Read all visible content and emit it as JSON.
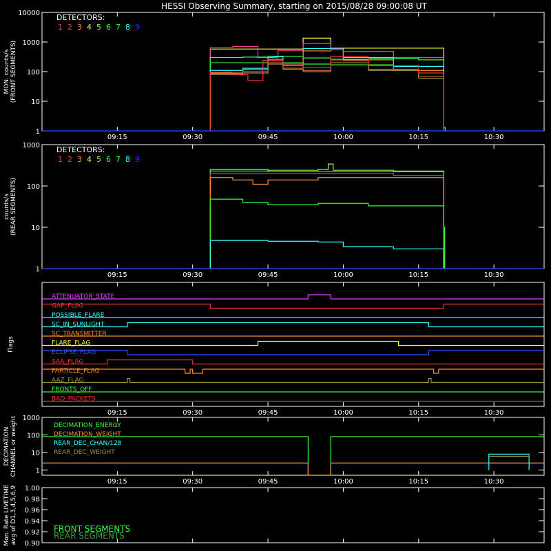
{
  "title": "HESSI Observing Summary, starting on 2015/08/28 09:00:08 UT",
  "time_ticks": [
    "09:15",
    "09:30",
    "09:45",
    "10:00",
    "10:15",
    "10:30"
  ],
  "detector_colors": [
    "#ff3050",
    "#ff3030",
    "#ff8c30",
    "#ffff30",
    "#90ff30",
    "#30ff60",
    "#30ff30",
    "#30ffff",
    "#3030ff"
  ],
  "chart_data": [
    {
      "type": "line",
      "ylabel_1": "MON. counts/s",
      "ylabel_2": "(FRONT SEGMENTS)",
      "yscale": "log",
      "ylim": [
        1,
        10000
      ],
      "xlim": [
        "09:00",
        "10:40"
      ],
      "yticks": [
        "10000",
        "1000",
        "100",
        "10",
        "1"
      ],
      "legend_title": "DETECTORS:",
      "legend_items": [
        "1",
        "2",
        "3",
        "4",
        "5",
        "6",
        "7",
        "8",
        "9"
      ],
      "series": [
        {
          "color": "#ffff40",
          "points": [
            [
              33.5,
              1
            ],
            [
              33.5,
              580
            ],
            [
              52,
              600
            ],
            [
              52,
              1350
            ],
            [
              57.5,
              1350
            ],
            [
              57.5,
              620
            ],
            [
              80,
              580
            ],
            [
              80,
              560
            ],
            [
              80,
              1
            ]
          ]
        },
        {
          "color": "#ff40a0",
          "points": [
            [
              33.5,
              1
            ],
            [
              33.5,
              650
            ],
            [
              38,
              700
            ],
            [
              43,
              300
            ],
            [
              47,
              520
            ],
            [
              52,
              420
            ],
            [
              52,
              900
            ],
            [
              57.5,
              900
            ],
            [
              57.5,
              600
            ],
            [
              60,
              480
            ],
            [
              70,
              300
            ],
            [
              80,
              200
            ],
            [
              80,
              1
            ]
          ]
        },
        {
          "color": "#30ff60",
          "points": [
            [
              33.5,
              1
            ],
            [
              33.5,
              300
            ],
            [
              40,
              310
            ],
            [
              46,
              330
            ],
            [
              52,
              290
            ],
            [
              57.5,
              260
            ],
            [
              65,
              280
            ],
            [
              75,
              250
            ],
            [
              80,
              240
            ],
            [
              80,
              1
            ]
          ]
        },
        {
          "color": "#30ff30",
          "points": [
            [
              33.5,
              1
            ],
            [
              33.5,
              200
            ],
            [
              42,
              200
            ],
            [
              52,
              180
            ],
            [
              57.5,
              170
            ],
            [
              70,
              150
            ],
            [
              80,
              140
            ],
            [
              80,
              1
            ]
          ]
        },
        {
          "color": "#30ffff",
          "points": [
            [
              33.5,
              1
            ],
            [
              33.5,
              110
            ],
            [
              40,
              130
            ],
            [
              45,
              320
            ],
            [
              48,
              180
            ],
            [
              52,
              150
            ],
            [
              52,
              600
            ],
            [
              57.5,
              620
            ],
            [
              60,
              300
            ],
            [
              70,
              150
            ],
            [
              80,
              90
            ],
            [
              80,
              1.3
            ],
            [
              80.3,
              1
            ]
          ]
        },
        {
          "color": "#ff8c30",
          "points": [
            [
              33.5,
              1
            ],
            [
              33.5,
              90
            ],
            [
              40,
              120
            ],
            [
              45,
              260
            ],
            [
              48,
              160
            ],
            [
              52,
              130
            ],
            [
              52,
              500
            ],
            [
              57.5,
              550
            ],
            [
              60,
              250
            ],
            [
              70,
              110
            ],
            [
              80,
              50
            ],
            [
              80,
              1
            ]
          ]
        },
        {
          "color": "#c06040",
          "points": [
            [
              33.5,
              1
            ],
            [
              33.5,
              85
            ],
            [
              40,
              100
            ],
            [
              45,
              200
            ],
            [
              48,
              130
            ],
            [
              52,
              110
            ],
            [
              57.5,
              230
            ],
            [
              65,
              120
            ],
            [
              75,
              70
            ],
            [
              80,
              45
            ],
            [
              80,
              1
            ]
          ]
        },
        {
          "color": "#a09040",
          "points": [
            [
              33.5,
              1
            ],
            [
              33.5,
              80
            ],
            [
              40,
              90
            ],
            [
              45,
              180
            ],
            [
              48,
              120
            ],
            [
              52,
              100
            ],
            [
              57.5,
              200
            ],
            [
              65,
              110
            ],
            [
              75,
              60
            ],
            [
              80,
              40
            ],
            [
              80,
              1
            ]
          ]
        },
        {
          "color": "#ff3030",
          "points": [
            [
              33.5,
              1
            ],
            [
              33.5,
              95
            ],
            [
              38,
              80
            ],
            [
              41,
              50
            ],
            [
              44,
              240
            ],
            [
              48,
              180
            ],
            [
              52,
              140
            ],
            [
              57.5,
              320
            ],
            [
              65,
              160
            ],
            [
              75,
              90
            ],
            [
              80,
              55
            ],
            [
              80,
              1
            ]
          ]
        },
        {
          "color": "#3050ff",
          "points": [
            [
              0,
              1
            ],
            [
              100,
              1
            ]
          ]
        }
      ]
    },
    {
      "type": "line",
      "ylabel_1": "counts/s",
      "ylabel_2": "(REAR SEGMENTS)",
      "yscale": "log",
      "ylim": [
        1,
        1000
      ],
      "xlim": [
        "09:00",
        "10:40"
      ],
      "yticks": [
        "1000",
        "100",
        "10",
        "1"
      ],
      "legend_title": "DETECTORS:",
      "legend_items": [
        "1",
        "2",
        "3",
        "4",
        "5",
        "6",
        "7",
        "8",
        "9"
      ],
      "series": [
        {
          "color": "#90ff30",
          "points": [
            [
              33.5,
              1
            ],
            [
              33.5,
              250
            ],
            [
              45,
              240
            ],
            [
              55,
              250
            ],
            [
              57,
              340
            ],
            [
              58,
              240
            ],
            [
              70,
              230
            ],
            [
              80,
              200
            ],
            [
              80,
              1
            ]
          ]
        },
        {
          "color": "#30ff60",
          "points": [
            [
              33.5,
              1
            ],
            [
              33.5,
              230
            ],
            [
              45,
              220
            ],
            [
              60,
              220
            ],
            [
              80,
              190
            ],
            [
              80,
              1
            ]
          ]
        },
        {
          "color": "#ff3050",
          "points": [
            [
              33.5,
              1
            ],
            [
              33.5,
              200
            ],
            [
              45,
              200
            ],
            [
              60,
              200
            ],
            [
              70,
              180
            ],
            [
              80,
              170
            ],
            [
              80,
              1
            ]
          ]
        },
        {
          "color": "#ff8c30",
          "points": [
            [
              33.5,
              1
            ],
            [
              33.5,
              160
            ],
            [
              38,
              140
            ],
            [
              42,
              110
            ],
            [
              45,
              140
            ],
            [
              55,
              160
            ],
            [
              65,
              160
            ],
            [
              80,
              150
            ],
            [
              80,
              1
            ]
          ]
        },
        {
          "color": "#30ff30",
          "points": [
            [
              33.5,
              1
            ],
            [
              33.5,
              48
            ],
            [
              40,
              40
            ],
            [
              45,
              35
            ],
            [
              55,
              38
            ],
            [
              65,
              33
            ],
            [
              80,
              30
            ],
            [
              80,
              10
            ],
            [
              80.2,
              1
            ]
          ]
        },
        {
          "color": "#30ffff",
          "points": [
            [
              33.5,
              1
            ],
            [
              33.5,
              4.8
            ],
            [
              45,
              4.6
            ],
            [
              55,
              4.4
            ],
            [
              60,
              3.4
            ],
            [
              70,
              3.0
            ],
            [
              80,
              2.8
            ],
            [
              80,
              1
            ]
          ]
        },
        {
          "color": "#3050ff",
          "points": [
            [
              0,
              1
            ],
            [
              100,
              1
            ]
          ]
        }
      ]
    },
    {
      "type": "line",
      "ylabel_1": "Flags",
      "flags": [
        {
          "label": "ATTENUATOR_STATE",
          "color": "#e040ff",
          "steps": [
            [
              0,
              0
            ],
            [
              53,
              1
            ],
            [
              57.5,
              0
            ]
          ]
        },
        {
          "label": "GAP_FLAG",
          "color": "#ff3030",
          "steps": [
            [
              0,
              1
            ],
            [
              33.5,
              0
            ],
            [
              80,
              1
            ]
          ]
        },
        {
          "label": "POSSIBLE_FLARE",
          "color": "#30ffff",
          "steps": [
            [
              0,
              0
            ]
          ]
        },
        {
          "label": "SC_IN_SUNLIGHT",
          "color": "#30ffff",
          "steps": [
            [
              0,
              0
            ],
            [
              17,
              1
            ],
            [
              77,
              0
            ]
          ]
        },
        {
          "label": "SC_TRANSMITTER",
          "color": "#ff8c30",
          "steps": [
            [
              0,
              0
            ]
          ]
        },
        {
          "label": "FLARE_FLAG",
          "color": "#ffff40",
          "steps": [
            [
              0,
              0
            ],
            [
              43,
              1
            ],
            [
              71,
              0
            ]
          ]
        },
        {
          "label": "ECLIPSE_FLAG",
          "color": "#3050ff",
          "steps": [
            [
              0,
              1
            ],
            [
              17,
              0
            ],
            [
              77,
              1
            ]
          ]
        },
        {
          "label": "SAA_FLAG",
          "color": "#ff3030",
          "steps": [
            [
              0,
              0
            ],
            [
              13,
              1
            ],
            [
              30,
              0
            ]
          ]
        },
        {
          "label": "PARTICLE_FLAG",
          "color": "#ff8c30",
          "steps": [
            [
              0,
              1
            ],
            [
              28.5,
              0
            ],
            [
              29.5,
              1
            ],
            [
              30,
              0
            ],
            [
              32,
              1
            ],
            [
              78,
              0
            ],
            [
              79,
              1
            ]
          ]
        },
        {
          "label": "AAZ_FLAG",
          "color": "#a09040",
          "steps": [
            [
              0,
              0
            ],
            [
              17,
              1
            ],
            [
              17.5,
              0
            ],
            [
              77,
              1
            ],
            [
              77.5,
              0
            ]
          ]
        },
        {
          "label": "FRONTS_OFF",
          "color": "#30ff30",
          "steps": [
            [
              0,
              0
            ]
          ]
        },
        {
          "label": "BAD_PACKETS",
          "color": "#ff3030",
          "steps": [
            [
              0,
              0
            ]
          ]
        }
      ]
    },
    {
      "type": "line",
      "ylabel_1": "DECIMATION",
      "ylabel_2": "CHANNEL or weight",
      "yscale": "log",
      "ylim": [
        0.5,
        1000
      ],
      "yticks": [
        "1000",
        "100",
        "10",
        "1"
      ],
      "series": [
        {
          "label": "DECIMATION_ENERGY",
          "color": "#30ff30",
          "points": [
            [
              0,
              80
            ],
            [
              53,
              80
            ],
            [
              53,
              0.5
            ],
            [
              57.5,
              0.5
            ],
            [
              57.5,
              80
            ],
            [
              100,
              80
            ]
          ]
        },
        {
          "label": "DECIMATION_WEIGHT",
          "color": "#ff8c30",
          "points": [
            [
              0,
              2.5
            ],
            [
              53,
              2.5
            ],
            [
              53,
              0.5
            ],
            [
              57.5,
              0.5
            ],
            [
              57.5,
              2.5
            ],
            [
              100,
              2.5
            ]
          ]
        },
        {
          "label": "REAR_DEC_CHAN/128",
          "color": "#30ffff",
          "points": [
            [
              89,
              1
            ],
            [
              89,
              8
            ],
            [
              97,
              8
            ],
            [
              97,
              1
            ]
          ]
        },
        {
          "label": "REAR_DEC_WEIGHT",
          "color": "#a09040",
          "points": [
            [
              89,
              6
            ],
            [
              97,
              6
            ]
          ]
        }
      ]
    },
    {
      "type": "line",
      "ylabel_1": "Mon. Rate LIVETIME",
      "ylabel_2": "avg of D1,3,4,5,6,9",
      "ylim": [
        0.9,
        1.0
      ],
      "yticks": [
        "1.00",
        "0.98",
        "0.96",
        "0.94",
        "0.92",
        "0.90"
      ],
      "legend_items": [
        "FRONT SEGMENTS",
        "REAR SEGMENTS"
      ],
      "legend_colors": [
        "#30ff30",
        "#30a030"
      ],
      "series": []
    }
  ]
}
